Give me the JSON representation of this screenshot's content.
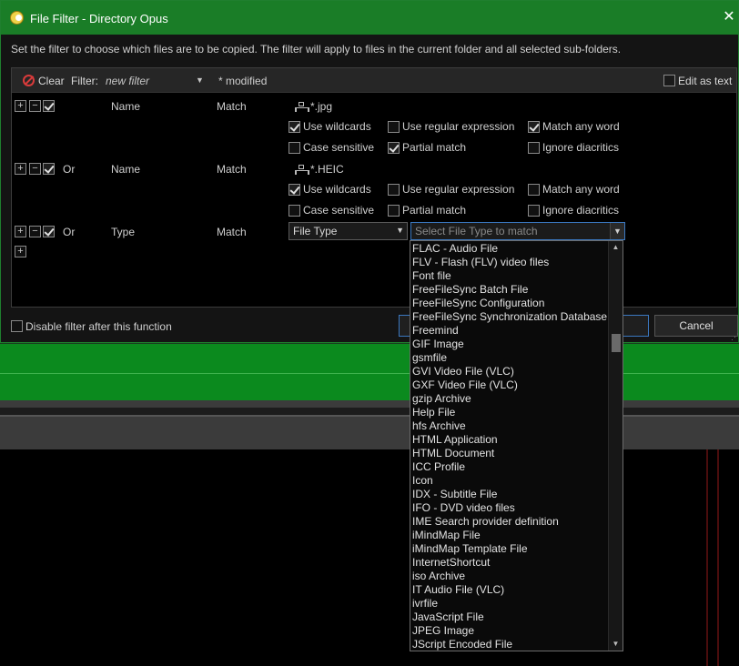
{
  "window": {
    "title": "File Filter - Directory Opus",
    "close_glyph": "✕"
  },
  "description": "Set the filter to choose which files are to be copied. The filter will apply to files in the current folder and all selected sub-folders.",
  "toolbar": {
    "clear_label": "Clear",
    "filter_label": "Filter:",
    "filter_value": "new filter",
    "modified_label": "* modified",
    "edit_as_text_label": "Edit as text",
    "edit_as_text_checked": false
  },
  "rules": [
    {
      "conjunction": "",
      "field": "Name",
      "operator": "Match",
      "pattern": "*.jpg",
      "options": [
        {
          "label": "Use wildcards",
          "checked": true
        },
        {
          "label": "Use regular expression",
          "checked": false
        },
        {
          "label": "Match any word",
          "checked": true
        },
        {
          "label": "Case sensitive",
          "checked": false
        },
        {
          "label": "Partial match",
          "checked": true
        },
        {
          "label": "Ignore diacritics",
          "checked": false
        }
      ]
    },
    {
      "conjunction": "Or",
      "field": "Name",
      "operator": "Match",
      "pattern": "*.HEIC",
      "options": [
        {
          "label": "Use wildcards",
          "checked": true
        },
        {
          "label": "Use regular expression",
          "checked": false
        },
        {
          "label": "Match any word",
          "checked": false
        },
        {
          "label": "Case sensitive",
          "checked": false
        },
        {
          "label": "Partial match",
          "checked": false
        },
        {
          "label": "Ignore diacritics",
          "checked": false
        }
      ]
    },
    {
      "conjunction": "Or",
      "field": "Type",
      "operator": "Match",
      "type_select": "File Type",
      "type_combo_placeholder": "Select File Type to match"
    }
  ],
  "rule_buttons": {
    "add": "+",
    "remove": "−"
  },
  "bottom": {
    "disable_label": "Disable filter after this function",
    "cancel_label": "Cancel"
  },
  "dropdown_items": [
    "FLAC - Audio File",
    "FLV - Flash (FLV) video files",
    "Font file",
    "FreeFileSync Batch File",
    "FreeFileSync Configuration",
    "FreeFileSync Synchronization Database",
    "Freemind",
    "GIF Image",
    "gsmfile",
    "GVI Video File (VLC)",
    "GXF Video File (VLC)",
    "gzip Archive",
    "Help File",
    "hfs Archive",
    "HTML Application",
    "HTML Document",
    "ICC Profile",
    "Icon",
    "IDX - Subtitle File",
    "IFO - DVD video files",
    "IME Search provider definition",
    "iMindMap File",
    "iMindMap Template File",
    "InternetShortcut",
    "iso Archive",
    "IT Audio File (VLC)",
    "ivrfile",
    "JavaScript File",
    "JPEG Image",
    "JScript Encoded File"
  ],
  "colors": {
    "titlebar": "#1a7d27",
    "accent_border": "#3b78c0",
    "clear_icon": "#d93b3b"
  }
}
